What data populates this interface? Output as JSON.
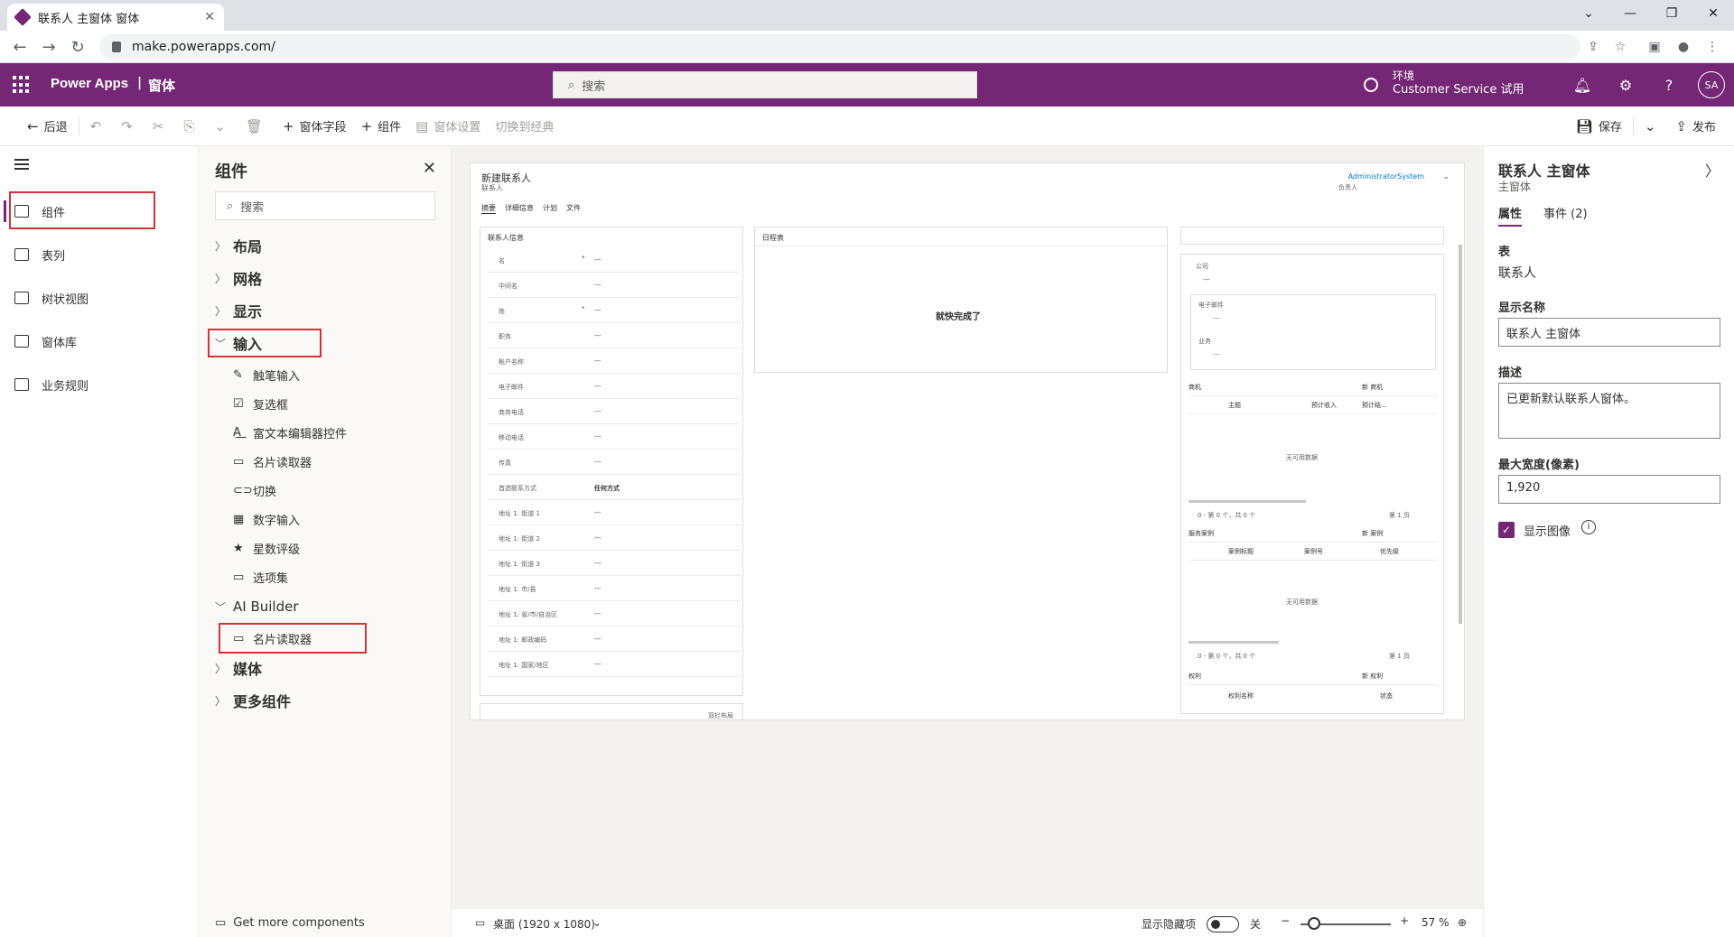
{
  "browser": {
    "tab_title": "联系人 主窗体 窗体",
    "url": "make.powerapps.com/"
  },
  "header": {
    "brand": "Power Apps",
    "crumb": "窗体",
    "search_placeholder": "搜索",
    "env_label": "环境",
    "env_name": "Customer Service 试用",
    "avatar": "SA",
    "brand_color": "#742774"
  },
  "commands": {
    "back": "后退",
    "form_field": "窗体字段",
    "component": "组件",
    "form_settings": "窗体设置",
    "switch_classic": "切换到经典",
    "save": "保存",
    "publish": "发布"
  },
  "rail": {
    "items": [
      {
        "label": "组件",
        "icon": "components-icon"
      },
      {
        "label": "表列",
        "icon": "table-columns-icon"
      },
      {
        "label": "树状视图",
        "icon": "tree-view-icon"
      },
      {
        "label": "窗体库",
        "icon": "form-library-icon"
      },
      {
        "label": "业务规则",
        "icon": "business-rules-icon"
      }
    ]
  },
  "components": {
    "title": "组件",
    "search_placeholder": "搜索",
    "groups": {
      "layout": "布局",
      "grid": "网格",
      "display": "显示",
      "input": "输入",
      "ai_builder": "AI Builder",
      "media": "媒体",
      "more": "更多组件"
    },
    "input_items": [
      {
        "label": "触笔输入",
        "icon": "pen-icon"
      },
      {
        "label": "复选框",
        "icon": "checkbox-icon"
      },
      {
        "label": "富文本编辑器控件",
        "icon": "rich-text-icon"
      },
      {
        "label": "名片读取器",
        "icon": "card-reader-icon"
      },
      {
        "label": "切换",
        "icon": "toggle-icon"
      },
      {
        "label": "数字输入",
        "icon": "number-icon"
      },
      {
        "label": "星数评级",
        "icon": "star-icon"
      },
      {
        "label": "选项集",
        "icon": "option-set-icon"
      }
    ],
    "ai_items": [
      {
        "label": "名片读取器",
        "icon": "card-reader-icon"
      }
    ],
    "get_more": "Get more components"
  },
  "form": {
    "title": "新建联系人",
    "subtitle": "联系人",
    "owner": "AdministratorSystem",
    "owner_sub": "负责人",
    "tabs": [
      "摘要",
      "详细信息",
      "计划",
      "文件"
    ],
    "section_title": "联系人信息",
    "fields": [
      {
        "label": "名",
        "value": "---",
        "required": true
      },
      {
        "label": "中间名",
        "value": "---"
      },
      {
        "label": "姓",
        "value": "---",
        "required": true
      },
      {
        "label": "职务",
        "value": "---"
      },
      {
        "label": "帐户名称",
        "value": "---"
      },
      {
        "label": "电子邮件",
        "value": "---"
      },
      {
        "label": "商务电话",
        "value": "---"
      },
      {
        "label": "移动电话",
        "value": "---"
      },
      {
        "label": "传真",
        "value": "---"
      },
      {
        "label": "首选联系方式",
        "value": "任何方式",
        "bold": true
      },
      {
        "label": "地址 1: 街道 1",
        "value": "---"
      },
      {
        "label": "地址 1: 街道 2",
        "value": "---"
      },
      {
        "label": "地址 1: 街道 3",
        "value": "---"
      },
      {
        "label": "地址 1: 市/县",
        "value": "---"
      },
      {
        "label": "地址 1: 省/市/自治区",
        "value": "---"
      },
      {
        "label": "地址 1: 邮政编码",
        "value": "---"
      },
      {
        "label": "地址 1: 国家/地区",
        "value": "---"
      }
    ],
    "timeline_title": "日程表",
    "timeline_text": "就快完成了",
    "company_label": "公司",
    "company_value": "---",
    "email_label": "电子邮件",
    "business_label": "业务",
    "opportunities": "商机",
    "new_opportunity": "新 商机",
    "col_topic": "主题",
    "col_est_revenue": "预计收入",
    "col_est_close": "预计结...",
    "no_data": "无可用数据",
    "paging": "0 - 第 0 个，共 0 个",
    "page": "第 1 页",
    "cases": "服务案例",
    "new_case": "新 案例",
    "col_case_title": "案例标题",
    "col_case_no": "案例号",
    "col_priority": "优先级",
    "entitlements": "权利",
    "new_entitlement": "新 权利",
    "col_ent_name": "权利名称",
    "col_status": "状态",
    "bottom_link": "双栏布局"
  },
  "properties": {
    "title": "联系人 主窗体",
    "subtitle": "主窗体",
    "tab_props": "属性",
    "tab_events": "事件 (2)",
    "table_label": "表",
    "table_value": "联系人",
    "display_name_label": "显示名称",
    "display_name_value": "联系人 主窗体",
    "description_label": "描述",
    "description_value": "已更新默认联系人窗体。",
    "max_width_label": "最大宽度(像素)",
    "max_width_value": "1,920",
    "show_image_label": "显示图像",
    "show_image_checked": true
  },
  "status": {
    "device": "桌面 (1920 x 1080)",
    "show_hidden": "显示隐藏项",
    "toggle_state": "关",
    "zoom": "57 %"
  }
}
